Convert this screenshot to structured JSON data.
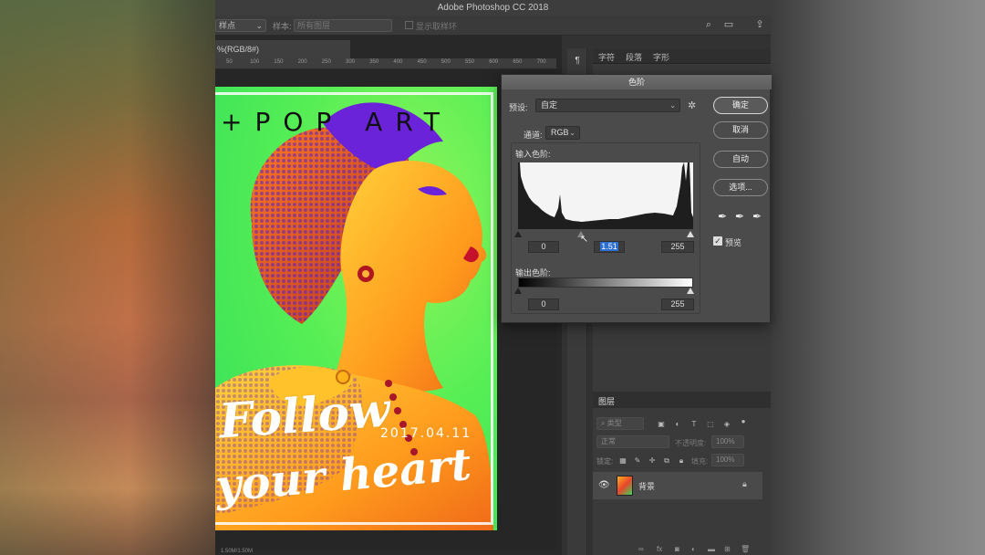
{
  "window": {
    "title": "Adobe Photoshop CC 2018"
  },
  "options_bar": {
    "sample_select": "样点",
    "sample_label": "样本:",
    "sample_value": "所有图层",
    "show_ring_label": "显示取样环"
  },
  "document": {
    "tab_label": "%(RGB/8#)",
    "ruler_ticks": [
      "50",
      "100",
      "150",
      "200",
      "250",
      "300",
      "350",
      "400",
      "450",
      "500",
      "550",
      "600",
      "650",
      "700"
    ],
    "status_text": "1.50M/1.50M"
  },
  "poster": {
    "title": "+POP ART",
    "date": "2017.04.11",
    "script_line1": "Follow",
    "script_line2": "your heart"
  },
  "character_panel": {
    "tabs": [
      "字符",
      "段落",
      "字形"
    ]
  },
  "levels_dialog": {
    "title": "色阶",
    "preset_label": "预设:",
    "preset_value": "自定",
    "channel_label": "通道:",
    "channel_value": "RGB",
    "input_levels_label": "输入色阶:",
    "input_black": "0",
    "input_gamma": "1.51",
    "input_white": "255",
    "output_levels_label": "输出色阶:",
    "output_black": "0",
    "output_white": "255",
    "buttons": {
      "ok": "确定",
      "cancel": "取消",
      "auto": "自动",
      "options": "选项..."
    },
    "preview_label": "预览",
    "preview_checked": true
  },
  "layers_panel": {
    "title": "图层",
    "filter_kind": "类型",
    "blend_mode": "正常",
    "opacity_label": "不透明度:",
    "opacity_value": "100%",
    "lock_label": "锁定:",
    "fill_label": "填充:",
    "fill_value": "100%",
    "layer_name": "背景",
    "footer_icons": [
      "link-icon",
      "fx-icon",
      "mask-icon",
      "adjustment-icon",
      "folder-icon",
      "new-layer-icon",
      "trash-icon"
    ]
  },
  "colors": {
    "poster_green": "#56ee55",
    "dialog_bg": "#4b4b4b",
    "selection_blue": "#2d6fd2"
  }
}
